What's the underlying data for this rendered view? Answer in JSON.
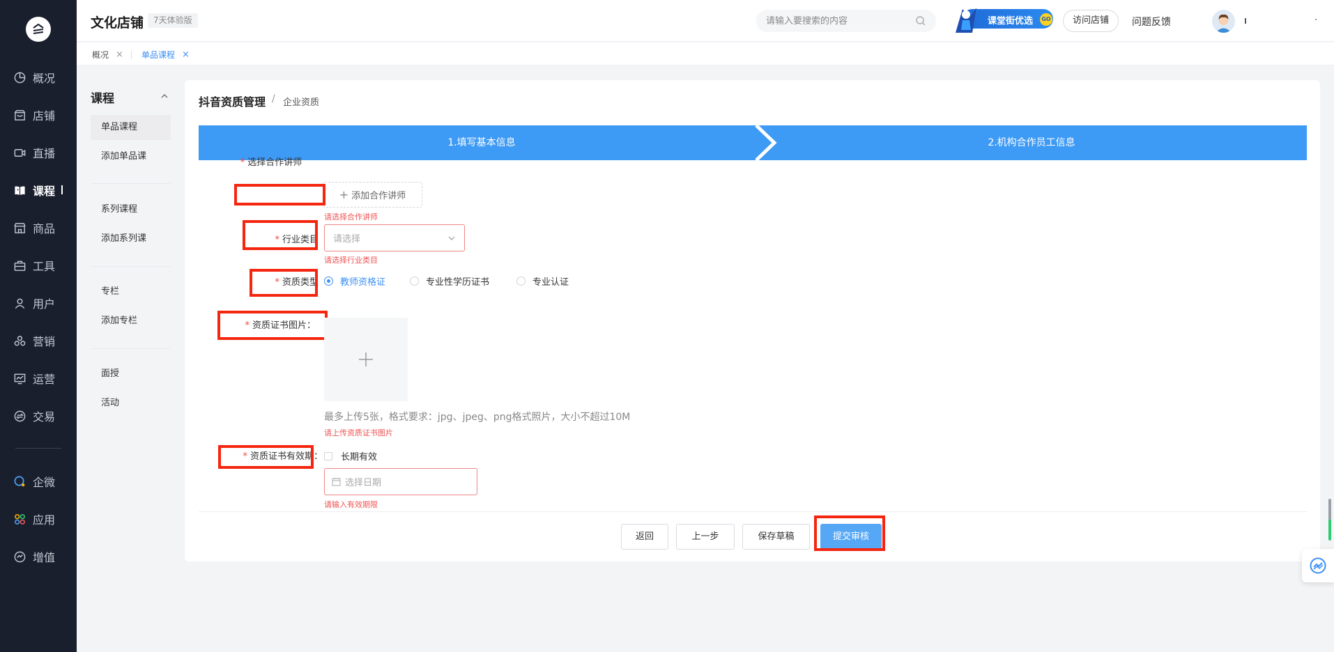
{
  "nav": {
    "items": [
      {
        "label": "概况",
        "icon": "pie-chart-icon"
      },
      {
        "label": "店铺",
        "icon": "store-icon"
      },
      {
        "label": "直播",
        "icon": "video-camera-icon"
      },
      {
        "label": "课程",
        "icon": "book-icon",
        "active": true
      },
      {
        "label": "商品",
        "icon": "shop-bag-icon"
      },
      {
        "label": "工具",
        "icon": "toolbox-icon"
      },
      {
        "label": "用户",
        "icon": "user-icon"
      },
      {
        "label": "营销",
        "icon": "marketing-icon"
      },
      {
        "label": "运营",
        "icon": "operation-chart-icon"
      },
      {
        "label": "交易",
        "icon": "exchange-icon"
      },
      {
        "label": "企微",
        "icon": "wecom-icon"
      },
      {
        "label": "应用",
        "icon": "apps-icon"
      },
      {
        "label": "增值",
        "icon": "value-added-icon"
      }
    ]
  },
  "header": {
    "shop_name": "文化店铺",
    "trial_badge": "7天体验版",
    "search_placeholder": "请输入要搜索的内容",
    "promo_text": "课堂街优选",
    "promo_go": "GO",
    "visit_store": "访问店铺",
    "feedback": "问题反馈"
  },
  "tabs": [
    {
      "label": "概况",
      "active": false
    },
    {
      "label": "单品课程",
      "active": true
    }
  ],
  "submenu": {
    "title": "课程",
    "groups": [
      [
        "单品课程",
        "添加单品课"
      ],
      [
        "系列课程",
        "添加系列课"
      ],
      [
        "专栏",
        "添加专栏"
      ],
      [
        "面授",
        "活动"
      ]
    ],
    "active": "单品课程"
  },
  "page": {
    "crumb_main": "抖音资质管理",
    "crumb_sep": "/",
    "crumb_sub": "企业资质",
    "steps": [
      "1.填写基本信息",
      "2.机构合作员工信息"
    ]
  },
  "form": {
    "required_mark": "*",
    "teacher_label": "选择合作讲师",
    "add_teacher": "添加合作讲师",
    "teacher_error": "请选择合作讲师",
    "industry_label": "行业类目",
    "industry_placeholder": "请选择",
    "industry_error": "请选择行业类目",
    "qual_type_label": "资质类型",
    "qual_types": [
      "教师资格证",
      "专业性学历证书",
      "专业认证"
    ],
    "qual_type_selected": "教师资格证",
    "cert_image_label": "资质证书图片：",
    "upload_tip": "最多上传5张，格式要求：jpg、jpeg、png格式照片，大小不超过10M",
    "cert_image_error": "请上传资质证书图片",
    "validity_label": "资质证书有效期：",
    "long_term": "长期有效",
    "date_placeholder": "选择日期",
    "validity_error": "请输入有效期限"
  },
  "footer": {
    "back": "返回",
    "prev": "上一步",
    "save_draft": "保存草稿",
    "submit": "提交审核"
  },
  "colors": {
    "nav_bg": "#1a1f2e",
    "accent": "#3d8ff5",
    "step_bg": "#3d9af5",
    "error": "#f05353",
    "highlight_box": "#f5260f"
  }
}
